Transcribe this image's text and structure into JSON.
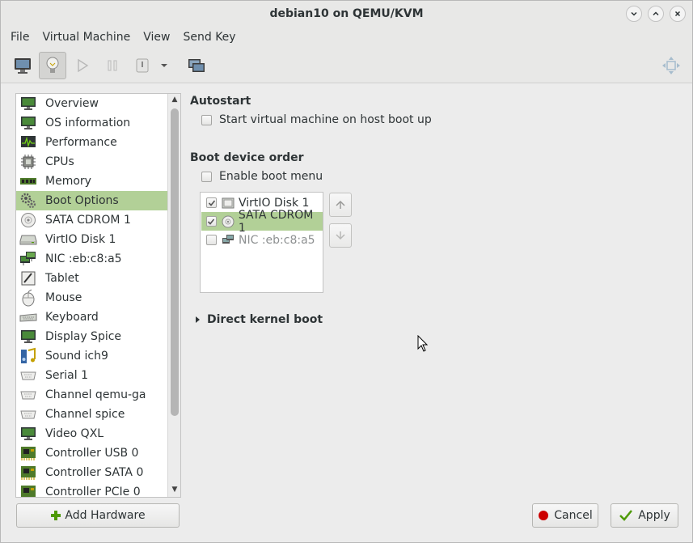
{
  "window": {
    "title": "debian10 on QEMU/KVM"
  },
  "menubar": {
    "items": [
      "File",
      "Virtual Machine",
      "View",
      "Send Key"
    ]
  },
  "toolbar": {
    "buttons": [
      {
        "icon": "monitor-icon"
      },
      {
        "icon": "lightbulb-icon",
        "active": true
      },
      {
        "icon": "play-icon"
      },
      {
        "icon": "pause-icon"
      },
      {
        "icon": "power-icon"
      },
      {
        "icon": "chevron-down-icon"
      },
      {
        "icon": "screens-icon"
      },
      {
        "icon": "fullscreen-icon"
      }
    ]
  },
  "sidebar": {
    "items": [
      {
        "label": "Overview",
        "icon": "monitor-icon"
      },
      {
        "label": "OS information",
        "icon": "monitor-icon"
      },
      {
        "label": "Performance",
        "icon": "performance-icon"
      },
      {
        "label": "CPUs",
        "icon": "cpu-icon"
      },
      {
        "label": "Memory",
        "icon": "memory-icon"
      },
      {
        "label": "Boot Options",
        "icon": "gears-icon",
        "selected": true
      },
      {
        "label": "SATA CDROM 1",
        "icon": "cdrom-icon"
      },
      {
        "label": "VirtIO Disk 1",
        "icon": "disk-icon"
      },
      {
        "label": "NIC :eb:c8:a5",
        "icon": "network-icon"
      },
      {
        "label": "Tablet",
        "icon": "tablet-icon"
      },
      {
        "label": "Mouse",
        "icon": "mouse-icon"
      },
      {
        "label": "Keyboard",
        "icon": "keyboard-icon"
      },
      {
        "label": "Display Spice",
        "icon": "monitor-icon"
      },
      {
        "label": "Sound ich9",
        "icon": "sound-icon"
      },
      {
        "label": "Serial 1",
        "icon": "serial-icon"
      },
      {
        "label": "Channel qemu-ga",
        "icon": "serial-icon"
      },
      {
        "label": "Channel spice",
        "icon": "serial-icon"
      },
      {
        "label": "Video QXL",
        "icon": "monitor-icon"
      },
      {
        "label": "Controller USB 0",
        "icon": "controller-icon"
      },
      {
        "label": "Controller SATA 0",
        "icon": "controller-icon"
      },
      {
        "label": "Controller PCIe 0",
        "icon": "controller-icon"
      }
    ],
    "add_hardware_label": "Add Hardware"
  },
  "main": {
    "autostart": {
      "heading": "Autostart",
      "checkbox_label": "Start virtual machine on host boot up",
      "checked": false
    },
    "boot_order": {
      "heading": "Boot device order",
      "enable_menu_label": "Enable boot menu",
      "enable_menu_checked": false,
      "devices": [
        {
          "label": "VirtIO Disk 1",
          "icon": "disk-icon",
          "checked": true,
          "selected": false,
          "enabled": true
        },
        {
          "label": "SATA CDROM 1",
          "icon": "cdrom-icon",
          "checked": true,
          "selected": true,
          "enabled": true
        },
        {
          "label": "NIC :eb:c8:a5",
          "icon": "network-icon",
          "checked": false,
          "selected": false,
          "enabled": false
        }
      ]
    },
    "direct_kernel_boot": {
      "label": "Direct kernel boot",
      "expanded": false
    }
  },
  "footer": {
    "cancel_label": "Cancel",
    "apply_label": "Apply"
  },
  "colors": {
    "selection": "#b2d097",
    "cancel_red": "#cc0000",
    "apply_green": "#4e9a06"
  }
}
